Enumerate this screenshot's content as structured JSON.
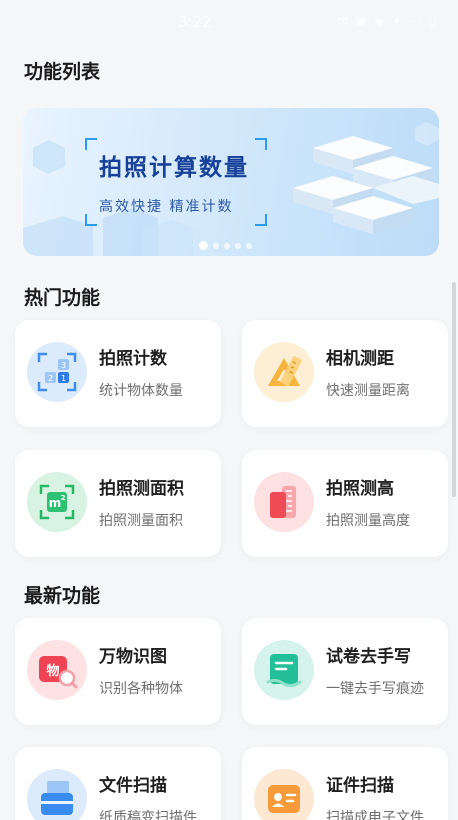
{
  "status_bar": {
    "time": "3:22",
    "icons": "✉ ▣ ◈ ✦ ⋯ ▯"
  },
  "sections": {
    "function_list": "功能列表",
    "hot": "热门功能",
    "new": "最新功能"
  },
  "banner": {
    "title": "拍照计算数量",
    "subtitle": "高效快捷 精准计数",
    "page_count": 5,
    "active_index": 0
  },
  "hot_features": [
    {
      "title": "拍照计数",
      "desc": "统计物体数量",
      "icon": "count-grid-icon"
    },
    {
      "title": "相机测距",
      "desc": "快速测量距离",
      "icon": "ruler-triangle-icon"
    },
    {
      "title": "拍照测面积",
      "desc": "拍照测量面积",
      "icon": "area-m2-icon"
    },
    {
      "title": "拍照测高",
      "desc": "拍照测量高度",
      "icon": "height-ruler-icon"
    }
  ],
  "new_features": [
    {
      "title": "万物识图",
      "desc": "识别各种物体",
      "icon": "object-recognize-icon",
      "badge": "物"
    },
    {
      "title": "试卷去手写",
      "desc": "一键去手写痕迹",
      "icon": "paper-erase-icon"
    },
    {
      "title": "文件扫描",
      "desc": "纸质稿变扫描件",
      "icon": "document-scan-icon"
    },
    {
      "title": "证件扫描",
      "desc": "扫描成电子文件",
      "icon": "id-card-icon"
    }
  ],
  "colors": {
    "accent_blue": "#2c9cf0",
    "banner_title": "#16409a"
  }
}
